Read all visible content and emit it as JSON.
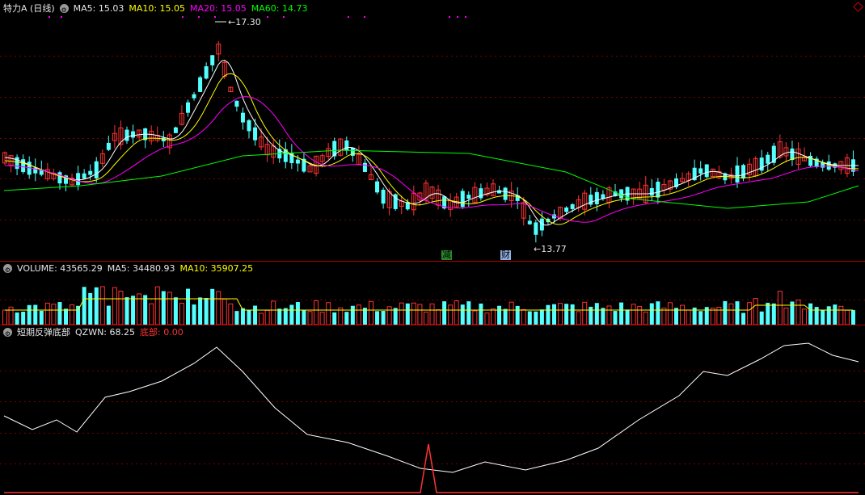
{
  "price_panel": {
    "title": "特力A (日线)",
    "ma5": "MA5: 15.03",
    "ma10": "MA10: 15.05",
    "ma20": "MA20: 15.05",
    "ma60": "MA60: 14.73",
    "high_label": "17.30",
    "low_label": "13.77",
    "tag_jian": "减",
    "tag_cai": "财"
  },
  "volume_panel": {
    "title": "VOLUME: 43565.29",
    "ma5": "MA5: 34480.93",
    "ma10": "MA10: 35907.25"
  },
  "indicator_panel": {
    "title": "短期反弹底部",
    "qzwn": "QZWN: 68.25",
    "dibu": "底部: 0.00"
  },
  "colors": {
    "up": "#ff3232",
    "down": "#54ffff",
    "ma5": "#ffffff",
    "ma10": "#ffff00",
    "ma20": "#ff00ff",
    "ma60": "#00ff00",
    "grid": "#7a0000"
  }
}
